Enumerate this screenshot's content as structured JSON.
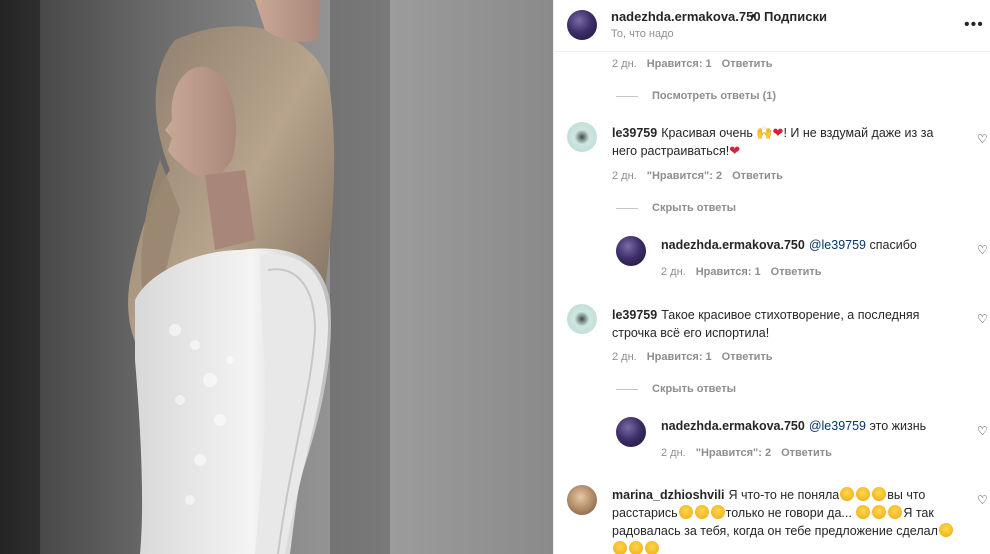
{
  "header": {
    "username": "nadezhda.ermakova.750",
    "dot": "•",
    "follow_label": "Подписки",
    "caption": "То, что надо",
    "more_icon": "more-horizontal-icon"
  },
  "top_meta": {
    "time": "2 дн.",
    "likes": "Нравится: 1",
    "reply": "Ответить"
  },
  "view_replies_1": "Посмотреть ответы (1)",
  "comments": [
    {
      "user": "le39759",
      "text_a": "Красивая очень",
      "text_b": "! И не вздумай даже из за него растраиваться!",
      "time": "2 дн.",
      "likes": "\"Нравится\": 2",
      "reply": "Ответить",
      "hide": "Скрыть ответы"
    },
    {
      "user": "nadezhda.ermakova.750",
      "mention": "@le39759",
      "text": "спасибо",
      "time": "2 дн.",
      "likes": "Нравится: 1",
      "reply": "Ответить"
    },
    {
      "user": "le39759",
      "text": "Такое красивое стихотворение, а последняя строчка всё его испортила!",
      "time": "2 дн.",
      "likes": "Нравится: 1",
      "reply": "Ответить",
      "hide": "Скрыть ответы"
    },
    {
      "user": "nadezhda.ermakova.750",
      "mention": "@le39759",
      "text": "это жизнь",
      "time": "2 дн.",
      "likes": "\"Нравится\": 2",
      "reply": "Ответить"
    },
    {
      "user": "marina_dzhioshvili",
      "text_a": "Я что-то не поняла",
      "text_b": "вы что расстарись",
      "text_c": "только не говори да...",
      "text_d": "Я так радовалась за тебя, когда он тебе предложение сделал"
    }
  ],
  "colors": {
    "accent_link": "#00376b",
    "secondary_text": "#8e8e8e",
    "heart": "#d8203a"
  }
}
